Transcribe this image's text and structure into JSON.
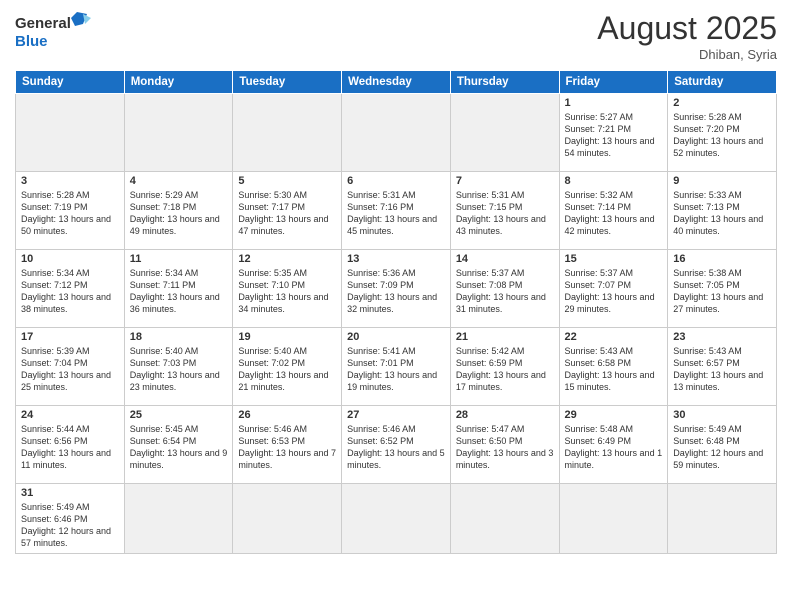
{
  "header": {
    "logo_general": "General",
    "logo_blue": "Blue",
    "month_title": "August 2025",
    "subtitle": "Dhiban, Syria"
  },
  "weekdays": [
    "Sunday",
    "Monday",
    "Tuesday",
    "Wednesday",
    "Thursday",
    "Friday",
    "Saturday"
  ],
  "weeks": [
    [
      {
        "day": "",
        "info": "",
        "empty": true
      },
      {
        "day": "",
        "info": "",
        "empty": true
      },
      {
        "day": "",
        "info": "",
        "empty": true
      },
      {
        "day": "",
        "info": "",
        "empty": true
      },
      {
        "day": "",
        "info": "",
        "empty": true
      },
      {
        "day": "1",
        "info": "Sunrise: 5:27 AM\nSunset: 7:21 PM\nDaylight: 13 hours and 54 minutes."
      },
      {
        "day": "2",
        "info": "Sunrise: 5:28 AM\nSunset: 7:20 PM\nDaylight: 13 hours and 52 minutes."
      }
    ],
    [
      {
        "day": "3",
        "info": "Sunrise: 5:28 AM\nSunset: 7:19 PM\nDaylight: 13 hours and 50 minutes."
      },
      {
        "day": "4",
        "info": "Sunrise: 5:29 AM\nSunset: 7:18 PM\nDaylight: 13 hours and 49 minutes."
      },
      {
        "day": "5",
        "info": "Sunrise: 5:30 AM\nSunset: 7:17 PM\nDaylight: 13 hours and 47 minutes."
      },
      {
        "day": "6",
        "info": "Sunrise: 5:31 AM\nSunset: 7:16 PM\nDaylight: 13 hours and 45 minutes."
      },
      {
        "day": "7",
        "info": "Sunrise: 5:31 AM\nSunset: 7:15 PM\nDaylight: 13 hours and 43 minutes."
      },
      {
        "day": "8",
        "info": "Sunrise: 5:32 AM\nSunset: 7:14 PM\nDaylight: 13 hours and 42 minutes."
      },
      {
        "day": "9",
        "info": "Sunrise: 5:33 AM\nSunset: 7:13 PM\nDaylight: 13 hours and 40 minutes."
      }
    ],
    [
      {
        "day": "10",
        "info": "Sunrise: 5:34 AM\nSunset: 7:12 PM\nDaylight: 13 hours and 38 minutes."
      },
      {
        "day": "11",
        "info": "Sunrise: 5:34 AM\nSunset: 7:11 PM\nDaylight: 13 hours and 36 minutes."
      },
      {
        "day": "12",
        "info": "Sunrise: 5:35 AM\nSunset: 7:10 PM\nDaylight: 13 hours and 34 minutes."
      },
      {
        "day": "13",
        "info": "Sunrise: 5:36 AM\nSunset: 7:09 PM\nDaylight: 13 hours and 32 minutes."
      },
      {
        "day": "14",
        "info": "Sunrise: 5:37 AM\nSunset: 7:08 PM\nDaylight: 13 hours and 31 minutes."
      },
      {
        "day": "15",
        "info": "Sunrise: 5:37 AM\nSunset: 7:07 PM\nDaylight: 13 hours and 29 minutes."
      },
      {
        "day": "16",
        "info": "Sunrise: 5:38 AM\nSunset: 7:05 PM\nDaylight: 13 hours and 27 minutes."
      }
    ],
    [
      {
        "day": "17",
        "info": "Sunrise: 5:39 AM\nSunset: 7:04 PM\nDaylight: 13 hours and 25 minutes."
      },
      {
        "day": "18",
        "info": "Sunrise: 5:40 AM\nSunset: 7:03 PM\nDaylight: 13 hours and 23 minutes."
      },
      {
        "day": "19",
        "info": "Sunrise: 5:40 AM\nSunset: 7:02 PM\nDaylight: 13 hours and 21 minutes."
      },
      {
        "day": "20",
        "info": "Sunrise: 5:41 AM\nSunset: 7:01 PM\nDaylight: 13 hours and 19 minutes."
      },
      {
        "day": "21",
        "info": "Sunrise: 5:42 AM\nSunset: 6:59 PM\nDaylight: 13 hours and 17 minutes."
      },
      {
        "day": "22",
        "info": "Sunrise: 5:43 AM\nSunset: 6:58 PM\nDaylight: 13 hours and 15 minutes."
      },
      {
        "day": "23",
        "info": "Sunrise: 5:43 AM\nSunset: 6:57 PM\nDaylight: 13 hours and 13 minutes."
      }
    ],
    [
      {
        "day": "24",
        "info": "Sunrise: 5:44 AM\nSunset: 6:56 PM\nDaylight: 13 hours and 11 minutes."
      },
      {
        "day": "25",
        "info": "Sunrise: 5:45 AM\nSunset: 6:54 PM\nDaylight: 13 hours and 9 minutes."
      },
      {
        "day": "26",
        "info": "Sunrise: 5:46 AM\nSunset: 6:53 PM\nDaylight: 13 hours and 7 minutes."
      },
      {
        "day": "27",
        "info": "Sunrise: 5:46 AM\nSunset: 6:52 PM\nDaylight: 13 hours and 5 minutes."
      },
      {
        "day": "28",
        "info": "Sunrise: 5:47 AM\nSunset: 6:50 PM\nDaylight: 13 hours and 3 minutes."
      },
      {
        "day": "29",
        "info": "Sunrise: 5:48 AM\nSunset: 6:49 PM\nDaylight: 13 hours and 1 minute."
      },
      {
        "day": "30",
        "info": "Sunrise: 5:49 AM\nSunset: 6:48 PM\nDaylight: 12 hours and 59 minutes."
      }
    ],
    [
      {
        "day": "31",
        "info": "Sunrise: 5:49 AM\nSunset: 6:46 PM\nDaylight: 12 hours and 57 minutes.",
        "last": true
      },
      {
        "day": "",
        "info": "",
        "empty": true,
        "last": true
      },
      {
        "day": "",
        "info": "",
        "empty": true,
        "last": true
      },
      {
        "day": "",
        "info": "",
        "empty": true,
        "last": true
      },
      {
        "day": "",
        "info": "",
        "empty": true,
        "last": true
      },
      {
        "day": "",
        "info": "",
        "empty": true,
        "last": true
      },
      {
        "day": "",
        "info": "",
        "empty": true,
        "last": true
      }
    ]
  ]
}
